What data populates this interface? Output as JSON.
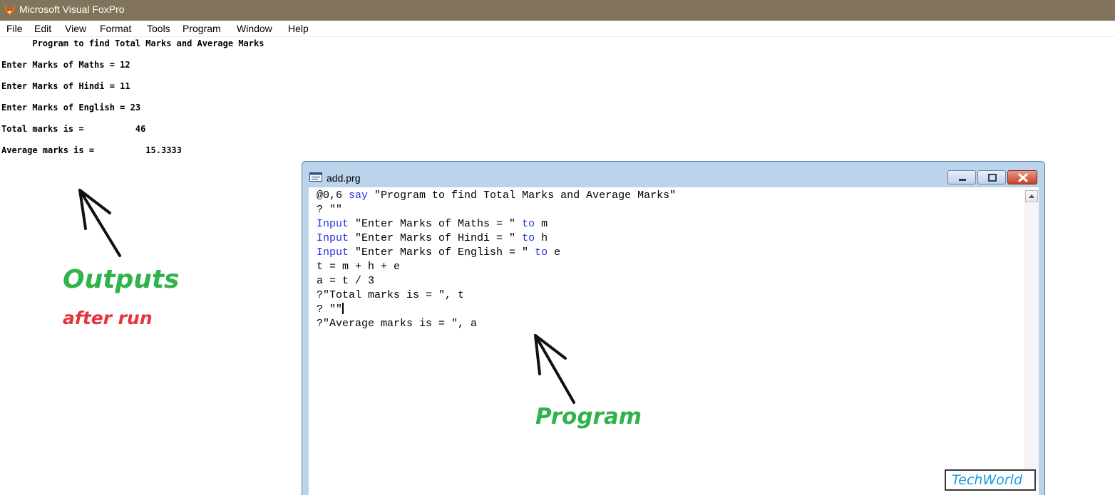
{
  "app": {
    "title": "Microsoft Visual FoxPro",
    "icon": "fox-icon"
  },
  "menu": {
    "items": [
      "File",
      "Edit",
      "View",
      "Format",
      "Tools",
      "Program",
      "Window",
      "Help"
    ]
  },
  "output": {
    "lines": [
      "      Program to find Total Marks and Average Marks",
      "Enter Marks of Maths = 12",
      "Enter Marks of Hindi = 11",
      "Enter Marks of English = 23",
      "Total marks is =          46",
      "Average marks is =          15.3333"
    ]
  },
  "annotations": {
    "outputs_label": "Outputs",
    "after_run_label": "after run",
    "program_label": "Program",
    "green_color": "#2fb34a",
    "red_color": "#e8343b"
  },
  "editor": {
    "title": "add.prg",
    "icon": "text-file-icon",
    "keyword_color": "#2431e5",
    "lines": [
      [
        {
          "t": "@0,6 "
        },
        {
          "t": "say",
          "kw": true
        },
        {
          "t": " \"Program to find Total Marks and Average Marks\""
        }
      ],
      [
        {
          "t": "? \"\""
        }
      ],
      [
        {
          "t": "Input",
          "kw": true
        },
        {
          "t": " \"Enter Marks of Maths = \" "
        },
        {
          "t": "to",
          "kw": true
        },
        {
          "t": " m"
        }
      ],
      [
        {
          "t": "Input",
          "kw": true
        },
        {
          "t": " \"Enter Marks of Hindi = \" "
        },
        {
          "t": "to",
          "kw": true
        },
        {
          "t": " h"
        }
      ],
      [
        {
          "t": "Input",
          "kw": true
        },
        {
          "t": " \"Enter Marks of English = \" "
        },
        {
          "t": "to",
          "kw": true
        },
        {
          "t": " e"
        }
      ],
      [
        {
          "t": "t = m + h + e"
        }
      ],
      [
        {
          "t": "a = t / 3"
        }
      ],
      [
        {
          "t": "?\"Total marks is = \", t"
        }
      ],
      [
        {
          "t": "? \"\""
        },
        {
          "caret": true
        }
      ],
      [
        {
          "t": "?\"Average marks is = \", a"
        }
      ]
    ]
  },
  "watermark": {
    "text": "TechWorld",
    "color": "#1d9ae3"
  }
}
